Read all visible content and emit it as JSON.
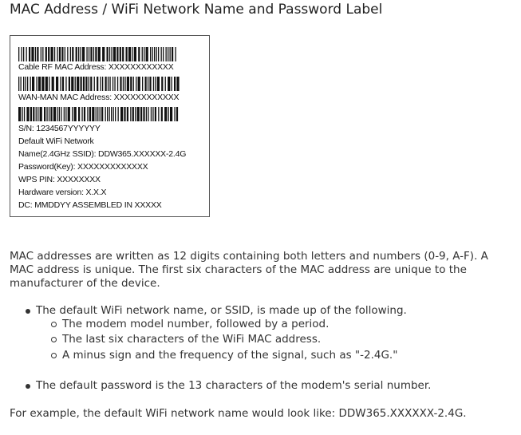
{
  "title": "MAC Address / WiFi Network Name and Password Label",
  "label": {
    "lines": {
      "cable_rf_mac": "Cable RF MAC  Address: XXXXXXXXXXXX",
      "wan_man_mac": "WAN-MAN  MAC  Address: XXXXXXXXXXXX",
      "serial": "S/N: 1234567YYYYYY",
      "wifi_network": "Default WiFi Network",
      "ssid": "Name(2.4GHz SSID): DDW365.XXXXXX-2.4G",
      "password": "Password(Key): XXXXXXXXXXXXX",
      "wps_pin": "WPS PIN: XXXXXXXX",
      "hardware_version": "Hardware version: X.X.X",
      "dc": "DC: MMDDYY     ASSEMBLED IN XXXXX"
    }
  },
  "body": {
    "intro": "MAC addresses are written as 12 digits containing both letters and numbers (0-9, A-F). A MAC address is unique. The first six characters of the MAC address are unique to the manufacturer of the device.",
    "bullet_ssid": "The default WiFi network name, or SSID, is made up of the following.",
    "sub_items": [
      "The modem model number, followed by a period.",
      "The last six characters of the WiFi MAC address.",
      "A minus sign and the frequency of the signal, such as \"-2.4G.\""
    ],
    "bullet_password": "The default password is the 13 characters of the modem's serial number.",
    "example": "For example, the default WiFi network name would look like: DDW365.XXXXXX-2.4G."
  }
}
